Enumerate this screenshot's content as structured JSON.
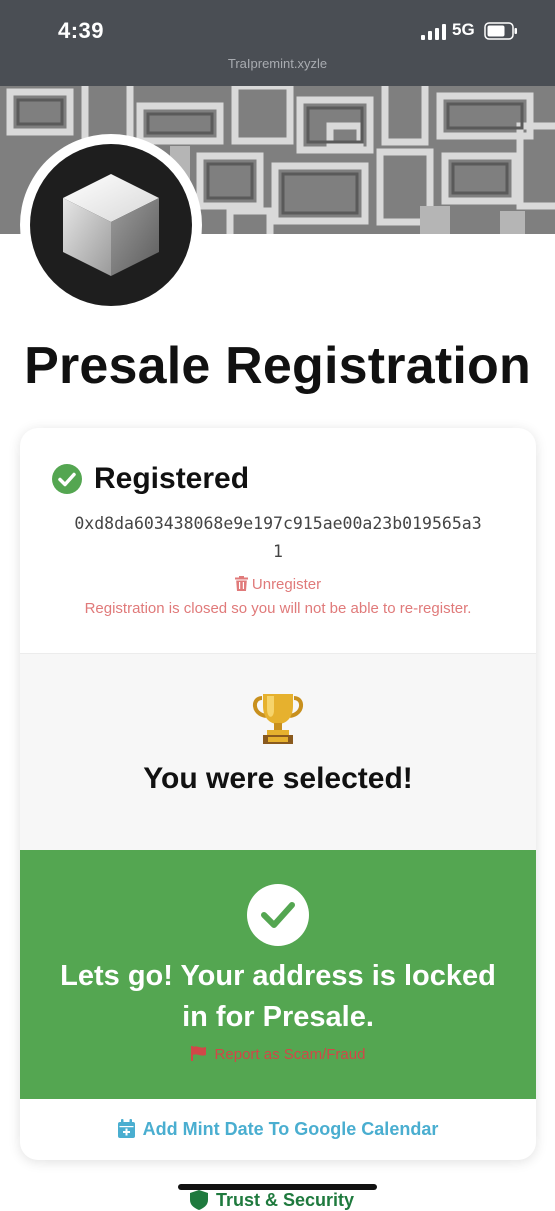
{
  "status_bar": {
    "time": "4:39",
    "network": "5G"
  },
  "browser": {
    "url": "Tra​Ipre​mint​.xyzle"
  },
  "page": {
    "title": "Presale Registration"
  },
  "registration": {
    "status": "Registered",
    "address_line1": "0xd8da603438068e9e197c915ae00a23b019565a3",
    "address_line2": "1",
    "unregister_label": "Unregister",
    "closed_note": "Registration is closed so you will not be able to re-register."
  },
  "selection": {
    "message": "You were selected!"
  },
  "locked": {
    "message": "Lets go! Your address is locked in for Presale.",
    "report_label": "Report as Scam/Fraud"
  },
  "calendar": {
    "label": "Add Mint Date To Google Calendar"
  },
  "bottom": {
    "peek_text": "Trust & Security"
  },
  "colors": {
    "accent_green": "#54a651",
    "danger": "#e07a7a",
    "link_blue": "#4aaed0",
    "status_bar": "#4a4e54"
  },
  "icons": [
    "cube-logo-icon",
    "check-circle-icon",
    "trash-icon",
    "trophy-icon",
    "check-icon",
    "flag-icon",
    "calendar-plus-icon",
    "shield-icon"
  ]
}
